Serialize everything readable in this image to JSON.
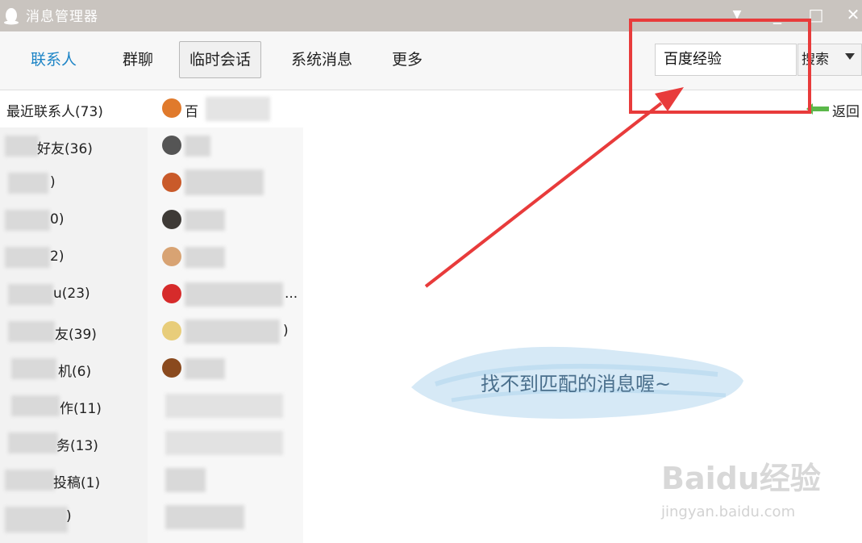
{
  "window": {
    "title": "消息管理器",
    "btn_minimize": "_",
    "btn_maximize": "□",
    "btn_close": "✕",
    "btn_menu": "▼"
  },
  "toolbar": {
    "tabs": [
      {
        "label": "联系人"
      },
      {
        "label": "群聊"
      },
      {
        "label": "临时会话"
      },
      {
        "label": "系统消息"
      },
      {
        "label": "更多"
      }
    ],
    "search_value": "百度经验",
    "search_button": "搜索"
  },
  "groups": [
    {
      "label": "最近联系人(73)"
    },
    {
      "label": "好友(36)"
    },
    {
      "label": ")"
    },
    {
      "label": "0)"
    },
    {
      "label": "2)"
    },
    {
      "label": "u(23)"
    },
    {
      "label": "友(39)"
    },
    {
      "label": "机(6)"
    },
    {
      "label": "作(11)"
    },
    {
      "label": "务(13)"
    },
    {
      "label": "投稿(1)"
    },
    {
      "label": ")"
    }
  ],
  "contacts": [
    {
      "name": "百"
    },
    {
      "name": ""
    },
    {
      "name": ""
    },
    {
      "name": ""
    },
    {
      "name": ""
    },
    {
      "name": "..."
    },
    {
      "name": ")"
    },
    {
      "name": ""
    },
    {
      "name": ""
    },
    {
      "name": ""
    },
    {
      "name": ""
    },
    {
      "name": ""
    }
  ],
  "right": {
    "back_label": "返回",
    "empty_message": "找不到匹配的消息喔~"
  },
  "watermark": {
    "brand": "Baidu经验",
    "url": "jingyan.baidu.com"
  },
  "colors": {
    "accent": "#1c84c6",
    "highlight": "#e83b3b"
  }
}
